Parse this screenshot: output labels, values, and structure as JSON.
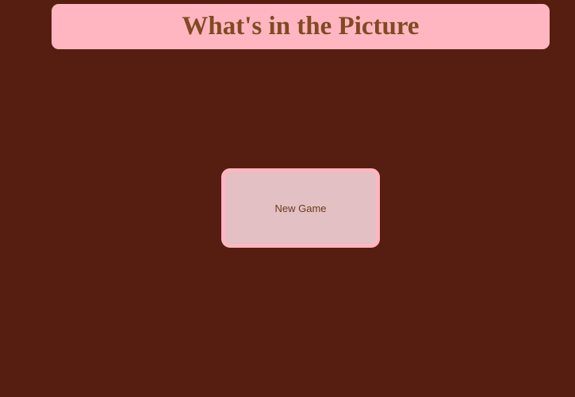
{
  "header": {
    "title": "What's in the Picture"
  },
  "menu": {
    "new_game_label": "New Game"
  },
  "colors": {
    "background": "#561e10",
    "banner": "#ffb6c1",
    "title_text": "#804a22",
    "button_fill": "#e2c0c4",
    "button_border": "#ffb6c1",
    "button_text": "#6b3d1a"
  }
}
